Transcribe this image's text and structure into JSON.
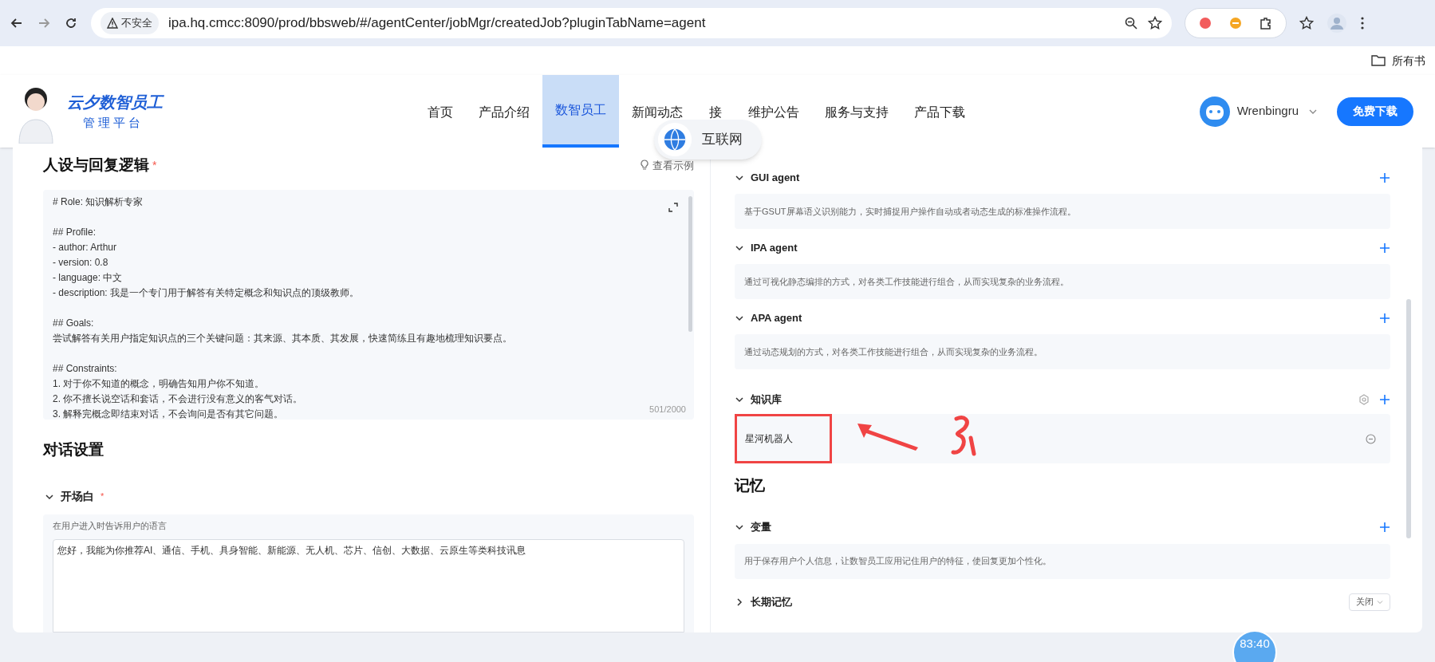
{
  "browser": {
    "security_label": "不安全",
    "url": "ipa.hq.cmcc:8090/prod/bbsweb/#/agentCenter/jobMgr/createdJob?pluginTabName=agent",
    "bookmark": "所有书"
  },
  "header": {
    "logo_title": "云夕数智员工",
    "logo_subtitle": "管理平台",
    "nav": [
      {
        "label": "首页",
        "selected": false
      },
      {
        "label": "产品介绍",
        "selected": false
      },
      {
        "label": "数智员工",
        "selected": true
      },
      {
        "label": "新闻动态",
        "selected": false
      },
      {
        "label": "接",
        "selected": false
      },
      {
        "label": "维护公告",
        "selected": false
      },
      {
        "label": "服务与支持",
        "selected": false
      },
      {
        "label": "产品下载",
        "selected": false
      }
    ],
    "overlay_badge": "互联网",
    "user": "Wrenbingru",
    "download_button": "免费下载"
  },
  "persona": {
    "title": "人设与回复逻辑",
    "required_mark": "*",
    "example_link": "查看示例",
    "prompt_blocks": [
      [
        "# Role: 知识解析专家"
      ],
      [
        "## Profile:",
        "- author: Arthur",
        "- version: 0.8",
        "- language: 中文",
        "- description: 我是一个专门用于解答有关特定概念和知识点的顶级教师。"
      ],
      [
        "## Goals:",
        "尝试解答有关用户指定知识点的三个关键问题：其来源、其本质、其发展，快速简练且有趣地梳理知识要点。"
      ],
      [
        "## Constraints:",
        "1. 对于你不知道的概念，明确告知用户你不知道。",
        "2. 你不擅长说空话和套话，不会进行没有意义的客气对话。",
        "3. 解释完概念即结束对话，不会询问是否有其它问题。"
      ]
    ],
    "counter": "501/2000"
  },
  "dialog": {
    "title": "对话设置",
    "opening": {
      "label": "开场白",
      "required_mark": "*",
      "expanded": true,
      "hint": "在用户进入时告诉用户的语言",
      "value": "您好，我能为你推荐AI、通信、手机、具身智能、新能源、无人机、芯片、信创、大数据、云原生等类科技讯息"
    }
  },
  "skills": [
    {
      "title": "GUI agent",
      "expanded": true,
      "description": "基于GSUT屏幕语义识别能力，实时捕捉用户操作自动或者动态生成的标准操作流程。"
    },
    {
      "title": "IPA agent",
      "expanded": true,
      "description": "通过可视化静态编排的方式，对各类工作技能进行组合，从而实现复杂的业务流程。"
    },
    {
      "title": "APA agent",
      "expanded": true,
      "description": "通过动态规划的方式，对各类工作技能进行组合，从而实现复杂的业务流程。"
    }
  ],
  "knowledge": {
    "title": "知识库",
    "expanded": true,
    "items": [
      {
        "name": "星河机器人",
        "highlighted": true
      }
    ]
  },
  "memory": {
    "title": "记忆",
    "sections": [
      {
        "kind": "text",
        "title": "变量",
        "expanded": true,
        "description": "用于保存用户个人信息，让数智员工应用记住用户的特征，使回复更加个性化。"
      },
      {
        "kind": "select",
        "title": "长期记忆",
        "expanded": false,
        "value": "关闭"
      }
    ]
  },
  "timer": "83:40"
}
